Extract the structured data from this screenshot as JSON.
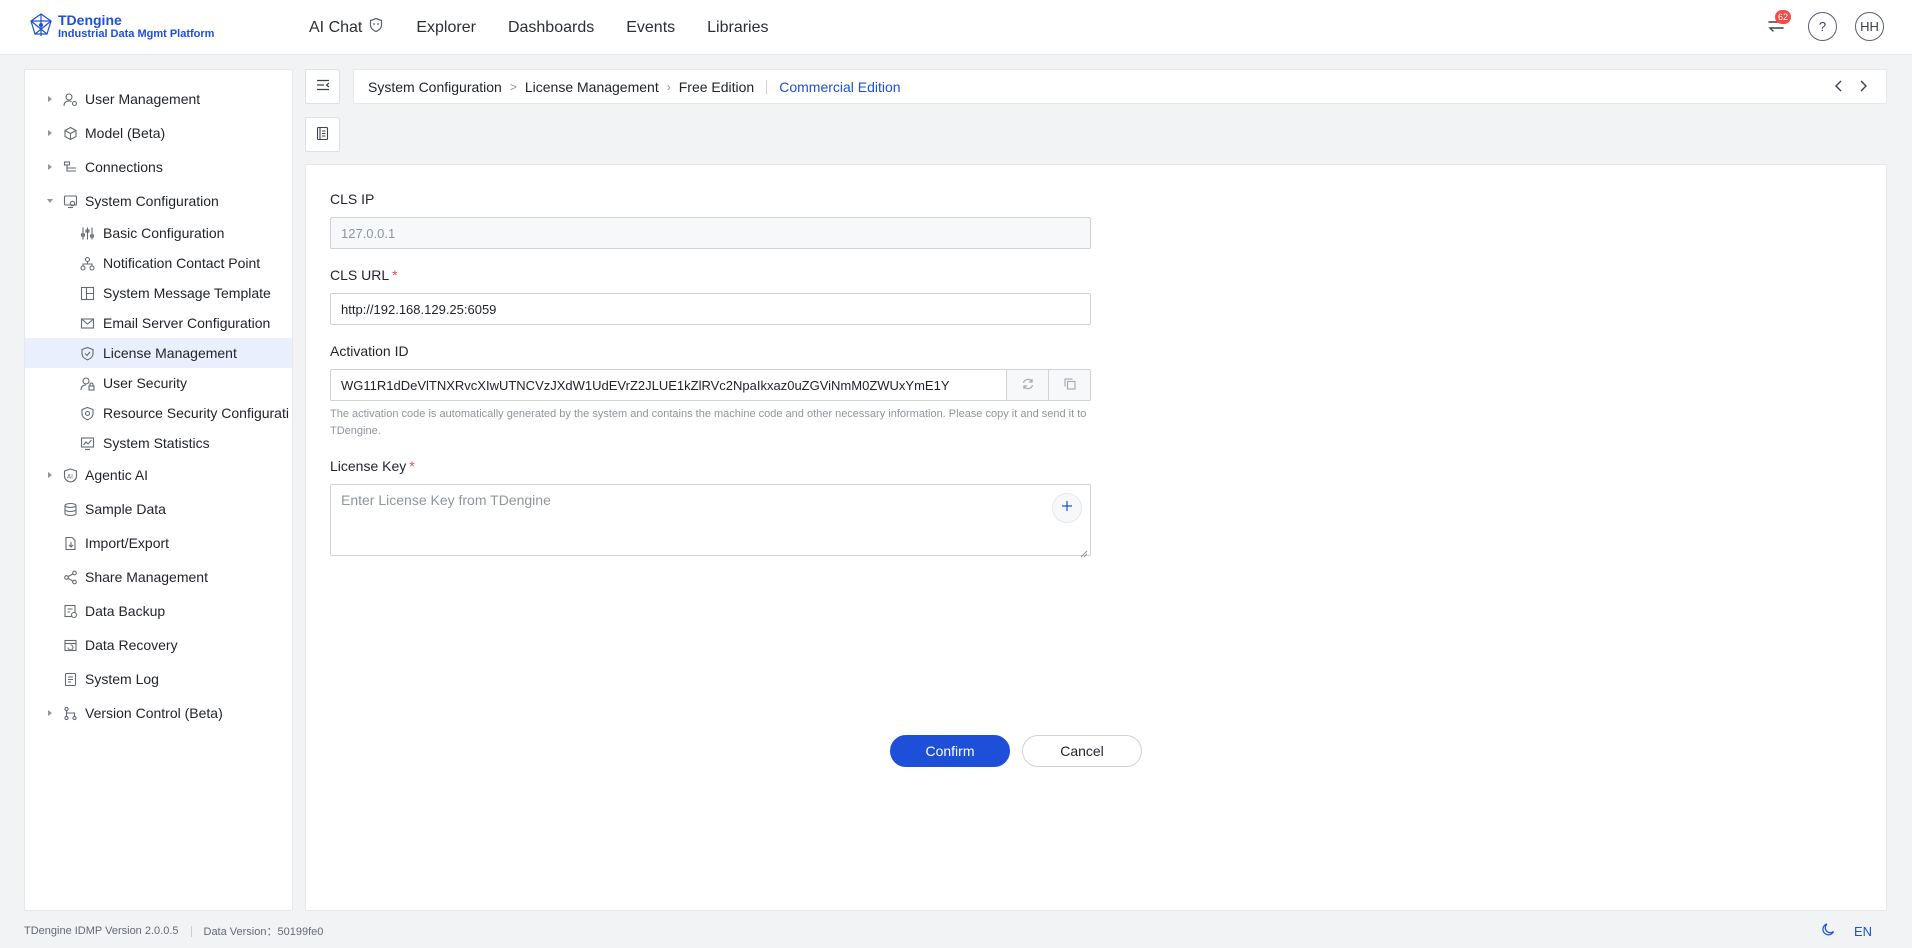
{
  "brand": {
    "name": "TDengine",
    "subtitle": "Industrial Data Mgmt Platform"
  },
  "nav": {
    "items": [
      {
        "label": "AI Chat"
      },
      {
        "label": "Explorer"
      },
      {
        "label": "Dashboards"
      },
      {
        "label": "Events"
      },
      {
        "label": "Libraries"
      }
    ]
  },
  "topbar": {
    "notification_count": "62",
    "help_label": "?",
    "avatar_initials": "HH"
  },
  "sidebar": {
    "items": [
      {
        "label": "User Management"
      },
      {
        "label": "Model (Beta)"
      },
      {
        "label": "Connections"
      },
      {
        "label": "System Configuration"
      },
      {
        "label": "Basic Configuration"
      },
      {
        "label": "Notification Contact Point"
      },
      {
        "label": "System Message Template"
      },
      {
        "label": "Email Server Configuration"
      },
      {
        "label": "License Management"
      },
      {
        "label": "User Security"
      },
      {
        "label": "Resource Security Configurati"
      },
      {
        "label": "System Statistics"
      },
      {
        "label": "Agentic AI"
      },
      {
        "label": "Sample Data"
      },
      {
        "label": "Import/Export"
      },
      {
        "label": "Share Management"
      },
      {
        "label": "Data Backup"
      },
      {
        "label": "Data Recovery"
      },
      {
        "label": "System Log"
      },
      {
        "label": "Version Control (Beta)"
      }
    ]
  },
  "breadcrumb": {
    "items": [
      {
        "label": "System Configuration"
      },
      {
        "label": "License Management"
      },
      {
        "label": "Free Edition"
      },
      {
        "label": "Commercial Edition"
      }
    ]
  },
  "form": {
    "cls_ip": {
      "label": "CLS IP",
      "value": "127.0.0.1"
    },
    "cls_url": {
      "label": "CLS URL",
      "required": "*",
      "value": "http://192.168.129.25:6059"
    },
    "activation": {
      "label": "Activation ID",
      "value": "WG11R1dDeVlTNXRvcXIwUTNCVzJXdW1UdEVrZ2JLUE1kZlRVc2NpaIkxaz0uZGViNmM0ZWUxYmE1Y",
      "help": "The activation code is automatically generated by the system and contains the machine code and other necessary information. Please copy it and send it to TDengine."
    },
    "license_key": {
      "label": "License Key",
      "required": "*",
      "placeholder": "Enter License Key from TDengine"
    },
    "confirm_label": "Confirm",
    "cancel_label": "Cancel"
  },
  "footer": {
    "version": "TDengine IDMP Version 2.0.0.5",
    "data_version": "Data Version：50199fe0",
    "language": "EN"
  },
  "colors": {
    "accent": "#1d4fd8",
    "badge": "#f54a45",
    "active_bg": "#e8f0fd"
  }
}
